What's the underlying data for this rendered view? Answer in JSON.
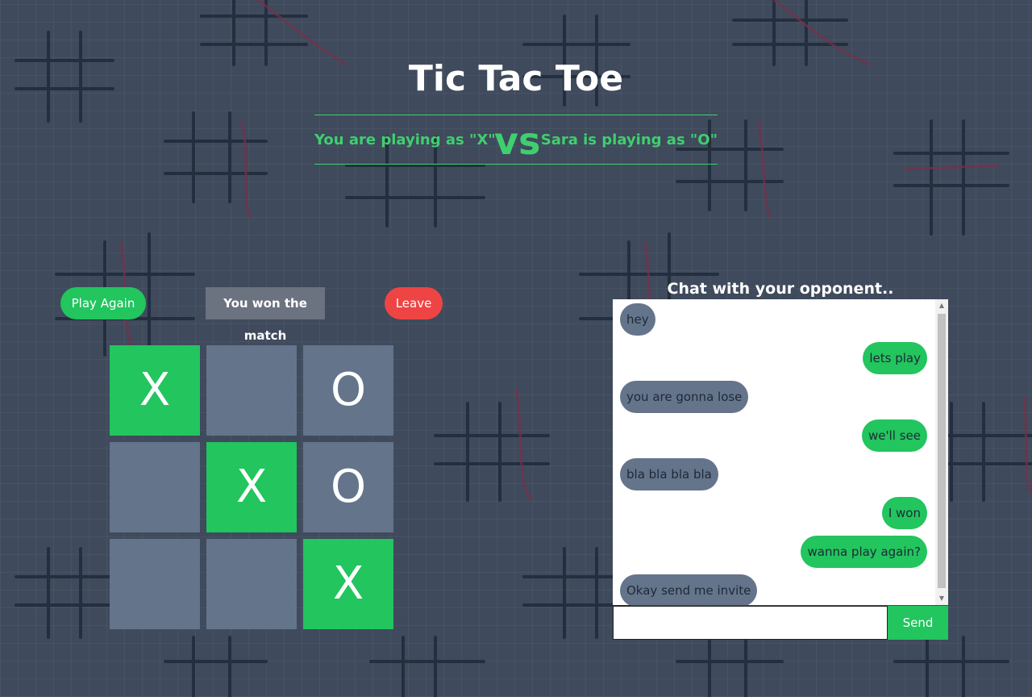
{
  "header": {
    "title": "Tic Tac Toe",
    "player_you": "You are playing as \"X\"",
    "vs": "vs",
    "player_opponent": "Sara is playing as \"O\""
  },
  "controls": {
    "play_again": "Play Again",
    "status": "You won the match",
    "leave": "Leave"
  },
  "board": {
    "cells": [
      "X",
      "",
      "O",
      "",
      "X",
      "O",
      "",
      "",
      "X"
    ]
  },
  "chat": {
    "title": "Chat with your opponent..",
    "messages": [
      {
        "from": "them",
        "text": "hey"
      },
      {
        "from": "me",
        "text": "lets play"
      },
      {
        "from": "them",
        "text": "you are gonna lose"
      },
      {
        "from": "me",
        "text": "we'll see"
      },
      {
        "from": "them",
        "text": "bla bla bla bla"
      },
      {
        "from": "me",
        "text": "I won"
      },
      {
        "from": "me",
        "text": "wanna play again?"
      },
      {
        "from": "them",
        "text": "Okay send me invite"
      }
    ],
    "input_value": "",
    "send_label": "Send"
  },
  "colors": {
    "background": "#3f4a5c",
    "accent_green": "#22c55e",
    "heading_green": "#3fcf6e",
    "leave_red": "#ef4444",
    "cell_gray": "#64748b",
    "status_gray": "#6b7280"
  }
}
